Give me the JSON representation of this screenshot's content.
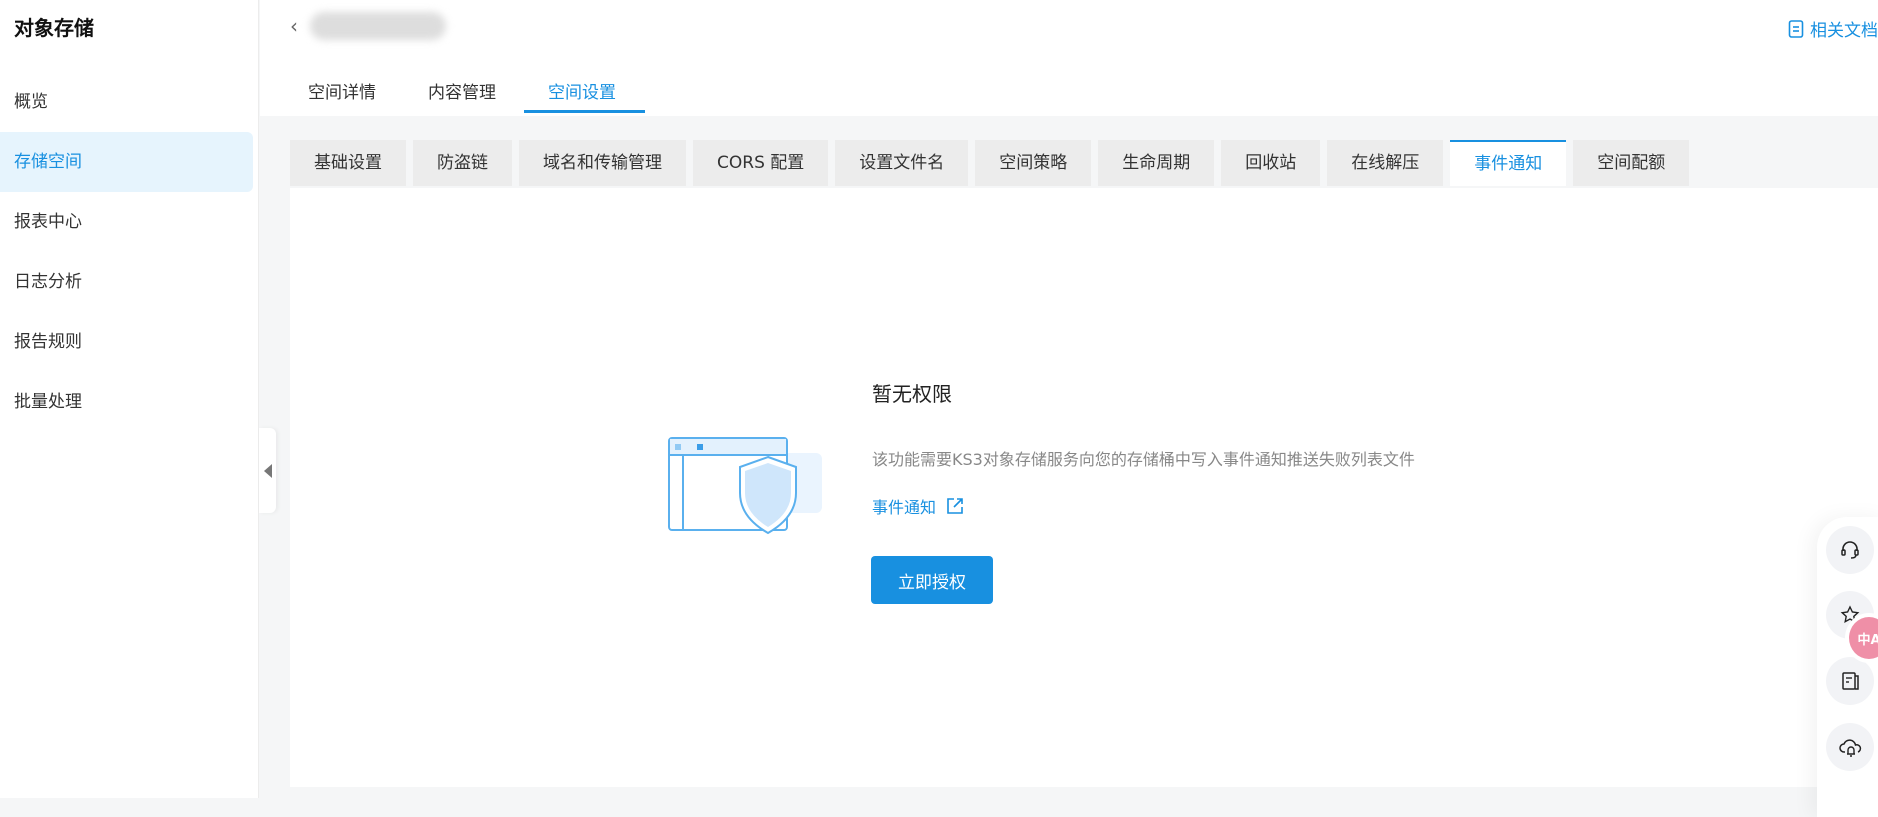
{
  "sidebar": {
    "title": "对象存储",
    "items": [
      {
        "label": "概览"
      },
      {
        "label": "存储空间",
        "active": true
      },
      {
        "label": "报表中心"
      },
      {
        "label": "日志分析"
      },
      {
        "label": "报告规则"
      },
      {
        "label": "批量处理"
      }
    ]
  },
  "header": {
    "docs_label": "相关文档",
    "tabs": [
      {
        "label": "空间详情"
      },
      {
        "label": "内容管理"
      },
      {
        "label": "空间设置",
        "active": true
      }
    ]
  },
  "subtabs": [
    {
      "label": "基础设置"
    },
    {
      "label": "防盗链"
    },
    {
      "label": "域名和传输管理"
    },
    {
      "label": "CORS 配置"
    },
    {
      "label": "设置文件名"
    },
    {
      "label": "空间策略"
    },
    {
      "label": "生命周期"
    },
    {
      "label": "回收站"
    },
    {
      "label": "在线解压"
    },
    {
      "label": "事件通知",
      "active": true
    },
    {
      "label": "空间配额"
    }
  ],
  "empty_state": {
    "title": "暂无权限",
    "description": "该功能需要KS3对象存储服务向您的存储桶中写入事件通知推送失败列表文件",
    "link_label": "事件通知",
    "button_label": "立即授权"
  },
  "floating_toolbar": {
    "icons": [
      "headset-icon",
      "star-icon",
      "document-icon",
      "cloud-bell-icon"
    ],
    "translate_badge": "中A"
  },
  "colors": {
    "accent": "#1890e0",
    "active_bg": "#e6f4fd"
  }
}
